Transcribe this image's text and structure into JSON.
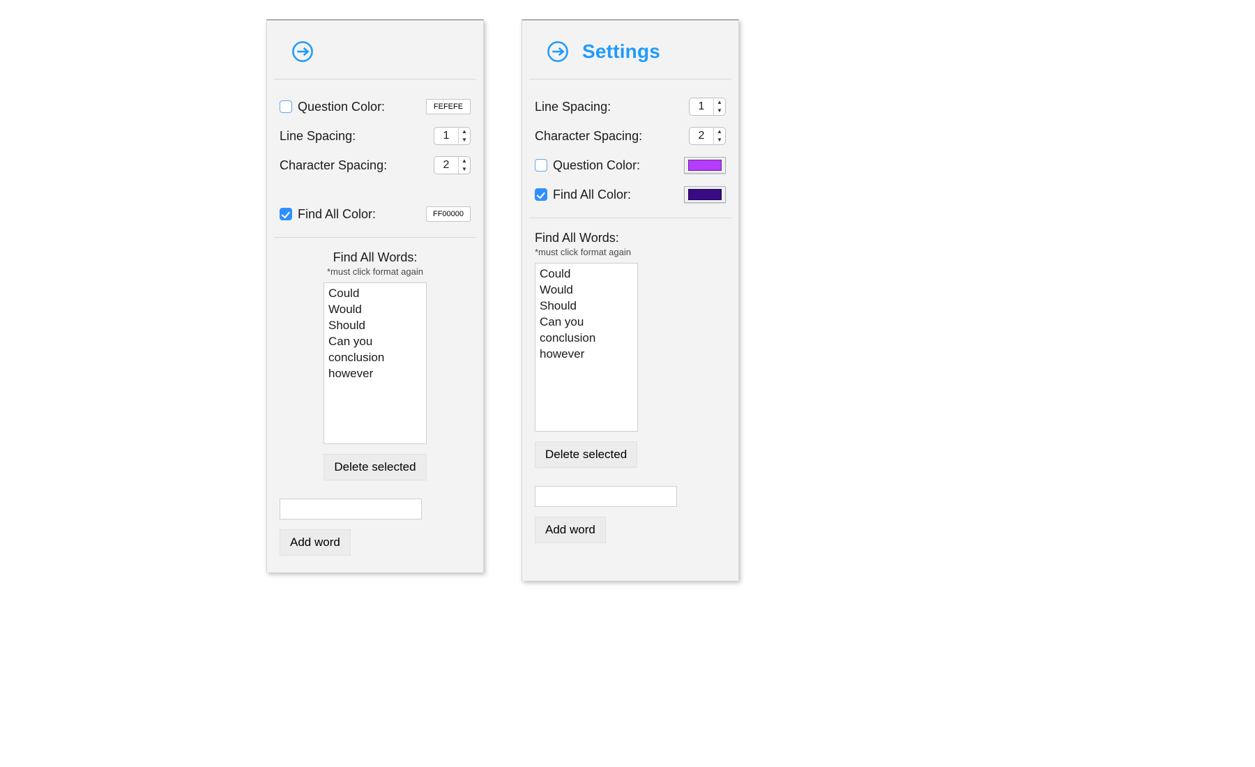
{
  "colors": {
    "accent": "#1e9bff",
    "question_swatch": "#b63cff",
    "findall_swatch": "#3a0a84"
  },
  "left": {
    "question_color": {
      "label": "Question Color:",
      "checked": false,
      "value": "FEFEFE"
    },
    "line_spacing": {
      "label": "Line Spacing:",
      "value": "1"
    },
    "char_spacing": {
      "label": "Character Spacing:",
      "value": "2"
    },
    "find_all_color": {
      "label": "Find All Color:",
      "checked": true,
      "value": "FF00000"
    },
    "words": {
      "label": "Find All Words:",
      "note": "*must click format again",
      "items": [
        "Could",
        "Would",
        "Should",
        "Can you",
        "conclusion",
        "however"
      ]
    },
    "delete_btn": "Delete selected",
    "add_btn": "Add word",
    "new_word_value": ""
  },
  "right": {
    "title": "Settings",
    "line_spacing": {
      "label": "Line Spacing:",
      "value": "1"
    },
    "char_spacing": {
      "label": "Character Spacing:",
      "value": "2"
    },
    "question_color": {
      "label": "Question Color:",
      "checked": false,
      "swatch": "#b63cff"
    },
    "find_all_color": {
      "label": "Find All Color:",
      "checked": true,
      "swatch": "#3a0a84"
    },
    "words": {
      "label": "Find All Words:",
      "note": "*must click format again",
      "items": [
        "Could",
        "Would",
        "Should",
        "Can you",
        "conclusion",
        "however"
      ]
    },
    "delete_btn": "Delete selected",
    "add_btn": "Add word",
    "new_word_value": ""
  }
}
